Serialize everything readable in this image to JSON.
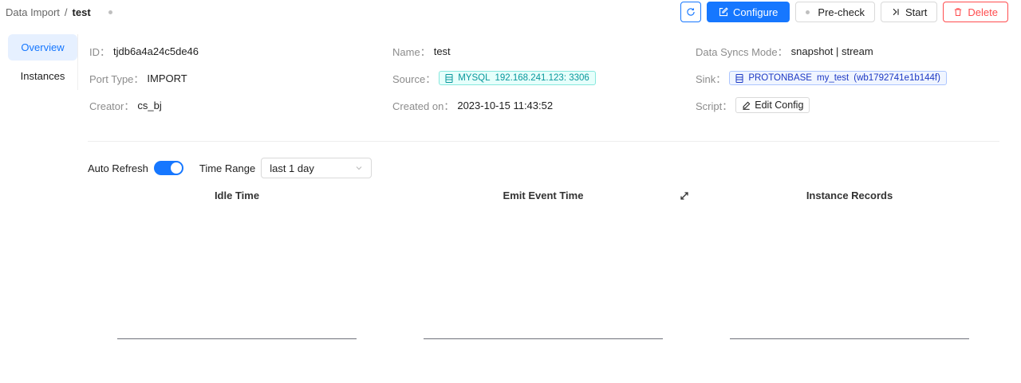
{
  "breadcrumb": {
    "parent": "Data Import",
    "separator": "/",
    "current": "test"
  },
  "actions": {
    "refresh_icon": "refresh-icon",
    "configure": "Configure",
    "precheck": "Pre-check",
    "start": "Start",
    "delete": "Delete"
  },
  "sidebar": {
    "items": [
      {
        "label": "Overview",
        "active": true
      },
      {
        "label": "Instances",
        "active": false
      }
    ]
  },
  "info": {
    "id": {
      "label": "ID",
      "value": "tjdb6a4a24c5de46"
    },
    "name": {
      "label": "Name",
      "value": "test"
    },
    "sync_mode": {
      "label": "Data Syncs Mode",
      "value": "snapshot | stream"
    },
    "port_type": {
      "label": "Port Type",
      "value": "IMPORT"
    },
    "source": {
      "label": "Source",
      "type": "MYSQL",
      "address": "192.168.241.123: 3306"
    },
    "sink": {
      "label": "Sink",
      "type": "PROTONBASE",
      "db": "my_test",
      "instance": "(wb1792741e1b144f)"
    },
    "creator": {
      "label": "Creator",
      "value": "cs_bj"
    },
    "created_on": {
      "label": "Created on",
      "value": "2023-10-15 11:43:52"
    },
    "script": {
      "label": "Script",
      "button": "Edit Config"
    },
    "colon": "："
  },
  "filters": {
    "auto_refresh_label": "Auto Refresh",
    "auto_refresh_on": true,
    "time_range_label": "Time Range",
    "time_range_value": "last 1 day"
  },
  "charts": [
    {
      "title": "Idle Time"
    },
    {
      "title": "Emit Event Time"
    },
    {
      "title": "Instance Records"
    }
  ],
  "colors": {
    "primary": "#1677ff",
    "danger": "#ff4d4f",
    "source_tag": "#08979c",
    "sink_tag": "#1d39c4"
  }
}
